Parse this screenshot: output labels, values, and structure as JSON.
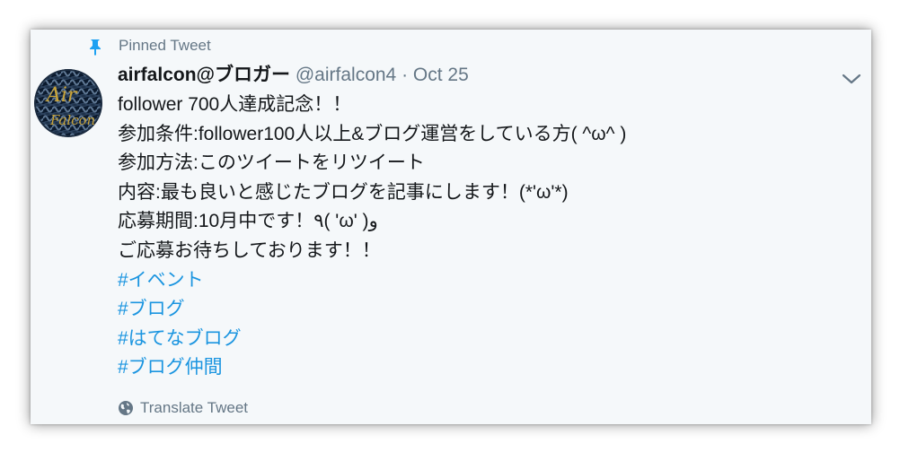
{
  "pinned": {
    "label": "Pinned Tweet",
    "icon": "pin-icon"
  },
  "tweet": {
    "display_name": "airfalcon@ブロガー",
    "handle": "@airfalcon4",
    "separator": "·",
    "date": "Oct 25",
    "avatar_letters": [
      "Air",
      "Falcon"
    ],
    "lines": [
      "follower 700人達成記念！！",
      "参加条件:follower100人以上&ブログ運営をしている方( ^ω^ )",
      "参加方法:このツイートをリツイート",
      "内容:最も良いと感じたブログを記事にします！(*'ω'*)",
      "応募期間:10月中です！٩( 'ω' )و",
      "ご応募お待ちしております！！"
    ],
    "hashtags": [
      "#イベント",
      "#ブログ",
      "#はてなブログ",
      "#ブログ仲間"
    ]
  },
  "actions": {
    "translate_label": "Translate Tweet",
    "translate_icon": "globe-icon",
    "menu_icon": "chevron-down-icon"
  },
  "colors": {
    "card_bg": "#f5f8fa",
    "text": "#14171a",
    "muted": "#657786",
    "link": "#1b95e0",
    "pin": "#1da1f2"
  }
}
